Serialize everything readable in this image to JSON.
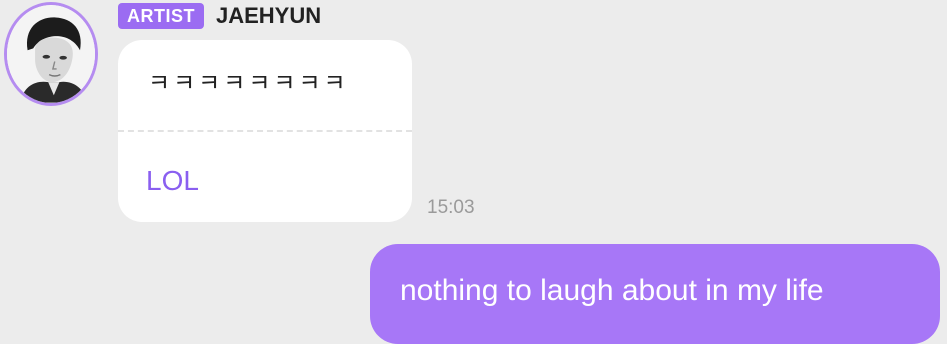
{
  "avatar": {
    "icon": "artist-avatar-portrait",
    "ring_color": "#b58cf0"
  },
  "header": {
    "badge_label": "ARTIST",
    "badge_color": "#9b6cf2",
    "sender_name": "JAEHYUN"
  },
  "incoming_message": {
    "original_text": "ㅋㅋㅋㅋㅋㅋㅋㅋ",
    "translation_text": "LOL",
    "translation_color": "#8a5ff0",
    "timestamp": "15:03"
  },
  "outgoing_message": {
    "text": "nothing to laugh about in my life",
    "bubble_color": "#a777f7"
  }
}
